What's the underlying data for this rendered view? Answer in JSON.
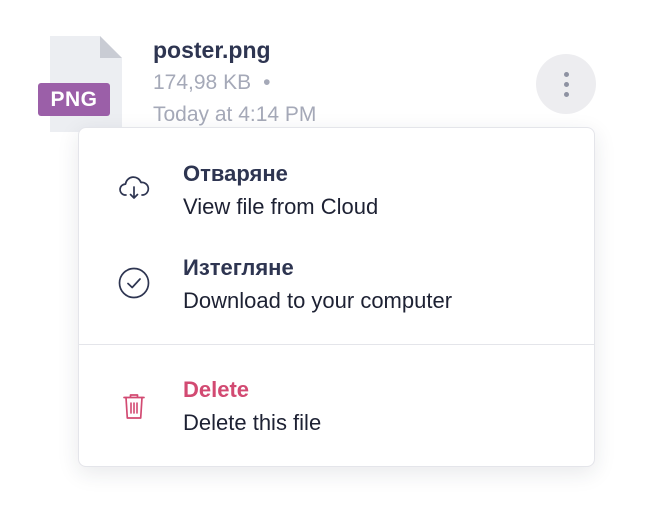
{
  "file": {
    "type_badge": "PNG",
    "name": "poster.png",
    "size": "174,98 KB",
    "separator": "•",
    "modified": "Today at 4:14 PM",
    "badge_color": "#9b5fa8"
  },
  "more_button": {
    "icon": "more-vertical-icon"
  },
  "menu": {
    "items": [
      {
        "icon": "cloud-download-icon",
        "title": "Отваряне",
        "subtitle": "View file from Cloud"
      },
      {
        "icon": "check-circle-icon",
        "title": "Изтегляне",
        "subtitle": "Download to your computer"
      },
      {
        "icon": "trash-icon",
        "title": "Delete",
        "subtitle": "Delete this file",
        "color": "#d24a72"
      }
    ]
  }
}
